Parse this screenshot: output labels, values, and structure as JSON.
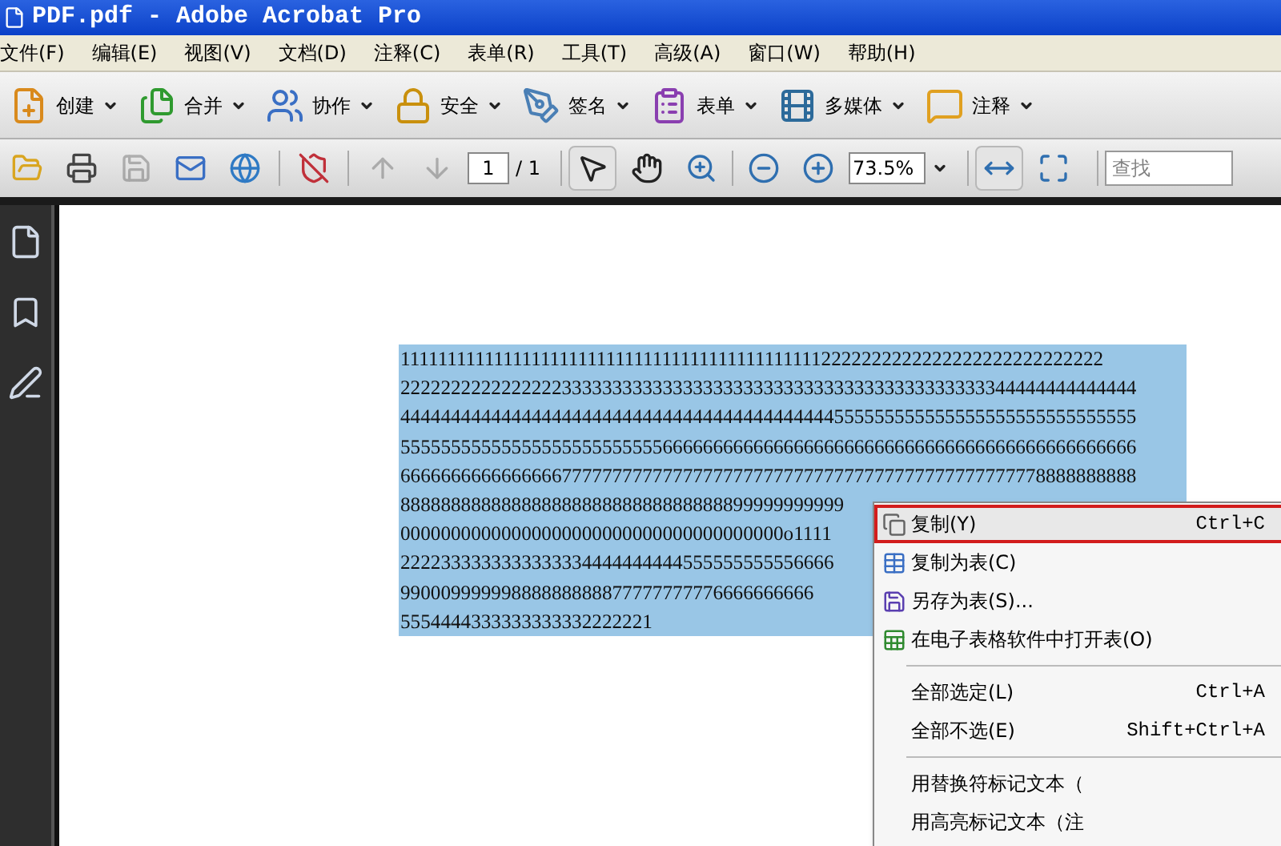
{
  "window": {
    "title": "PDF.pdf - Adobe Acrobat Pro"
  },
  "menu_bar": [
    "文件(F)",
    "编辑(E)",
    "视图(V)",
    "文档(D)",
    "注释(C)",
    "表单(R)",
    "工具(T)",
    "高级(A)",
    "窗口(W)",
    "帮助(H)"
  ],
  "task_toolbar": [
    {
      "kind": "create",
      "label": "创建"
    },
    {
      "kind": "combine",
      "label": "合并"
    },
    {
      "kind": "collaborate",
      "label": "协作"
    },
    {
      "kind": "secure",
      "label": "安全"
    },
    {
      "kind": "sign",
      "label": "签名"
    },
    {
      "kind": "forms",
      "label": "表单"
    },
    {
      "kind": "multimedia",
      "label": "多媒体"
    },
    {
      "kind": "comment",
      "label": "注释"
    }
  ],
  "nav_toolbar": {
    "tools_left": [
      {
        "kind": "open",
        "disabled": false
      },
      {
        "kind": "print",
        "disabled": false
      },
      {
        "kind": "save",
        "disabled": true
      },
      {
        "kind": "email",
        "disabled": false
      },
      {
        "kind": "upload",
        "disabled": false
      },
      {
        "kind": "secure",
        "disabled": false
      },
      {
        "kind": "prev",
        "disabled": true
      },
      {
        "kind": "next",
        "disabled": true
      }
    ],
    "page_field": "1",
    "page_total": "/ 1",
    "tools_mid": [
      {
        "kind": "select",
        "selected": true
      },
      {
        "kind": "hand",
        "selected": false
      },
      {
        "kind": "zoom",
        "selected": false
      },
      {
        "kind": "zoom-out",
        "selected": false
      },
      {
        "kind": "zoom-in",
        "selected": false
      }
    ],
    "zoom_field": "73.5%",
    "tools_right": [
      {
        "kind": "fit-width",
        "selected": true
      },
      {
        "kind": "fit-page",
        "selected": false
      }
    ],
    "search": {
      "placeholder": "查找"
    }
  },
  "side_panel": [
    {
      "kind": "pages"
    },
    {
      "kind": "bookmarks"
    },
    {
      "kind": "signatures"
    }
  ],
  "document": {
    "lines": [
      "1111111111111111111111111111111111111111111112222222222222222222222222222",
      "2222222222222222333333333333333333333333333333333333333333344444444444444",
      "4444444444444444444444444444444444444444444555555555555555555555555555555",
      "5555555555555555555555555566666666666666666666666666666666666666666666666",
      "6666666666666666777777777777777777777777777777777777777777777778888888888",
      "88888888888888888888888888888888899999999999",
      "00000000000000000000000000000000000000o1111",
      "2222333333333333334444444444555555555556666",
      "99000999999888888888877777777776666666666",
      "5554444333333333332222221"
    ]
  },
  "context_menu": [
    {
      "kind": "copy",
      "label": "复制(Y)",
      "shortcut": "Ctrl+C",
      "selected": true
    },
    {
      "kind": "table",
      "label": "复制为表(C)",
      "selected": false
    },
    {
      "kind": "save",
      "label": "另存为表(S)...",
      "selected": false
    },
    {
      "kind": "spreadsheet",
      "label": "在电子表格软件中打开表(O)",
      "selected": false
    },
    {
      "kind": "separator"
    },
    {
      "kind": "item",
      "label": "全部选定(L)",
      "shortcut": "Ctrl+A",
      "selected": false
    },
    {
      "kind": "item",
      "label": "全部不选(E)",
      "shortcut": "Shift+Ctrl+A",
      "selected": false
    },
    {
      "kind": "separator"
    },
    {
      "kind": "item",
      "label": "用替换符标记文本（",
      "selected": false
    },
    {
      "kind": "item",
      "label": "用高亮标记文本（注",
      "selected": false
    }
  ]
}
